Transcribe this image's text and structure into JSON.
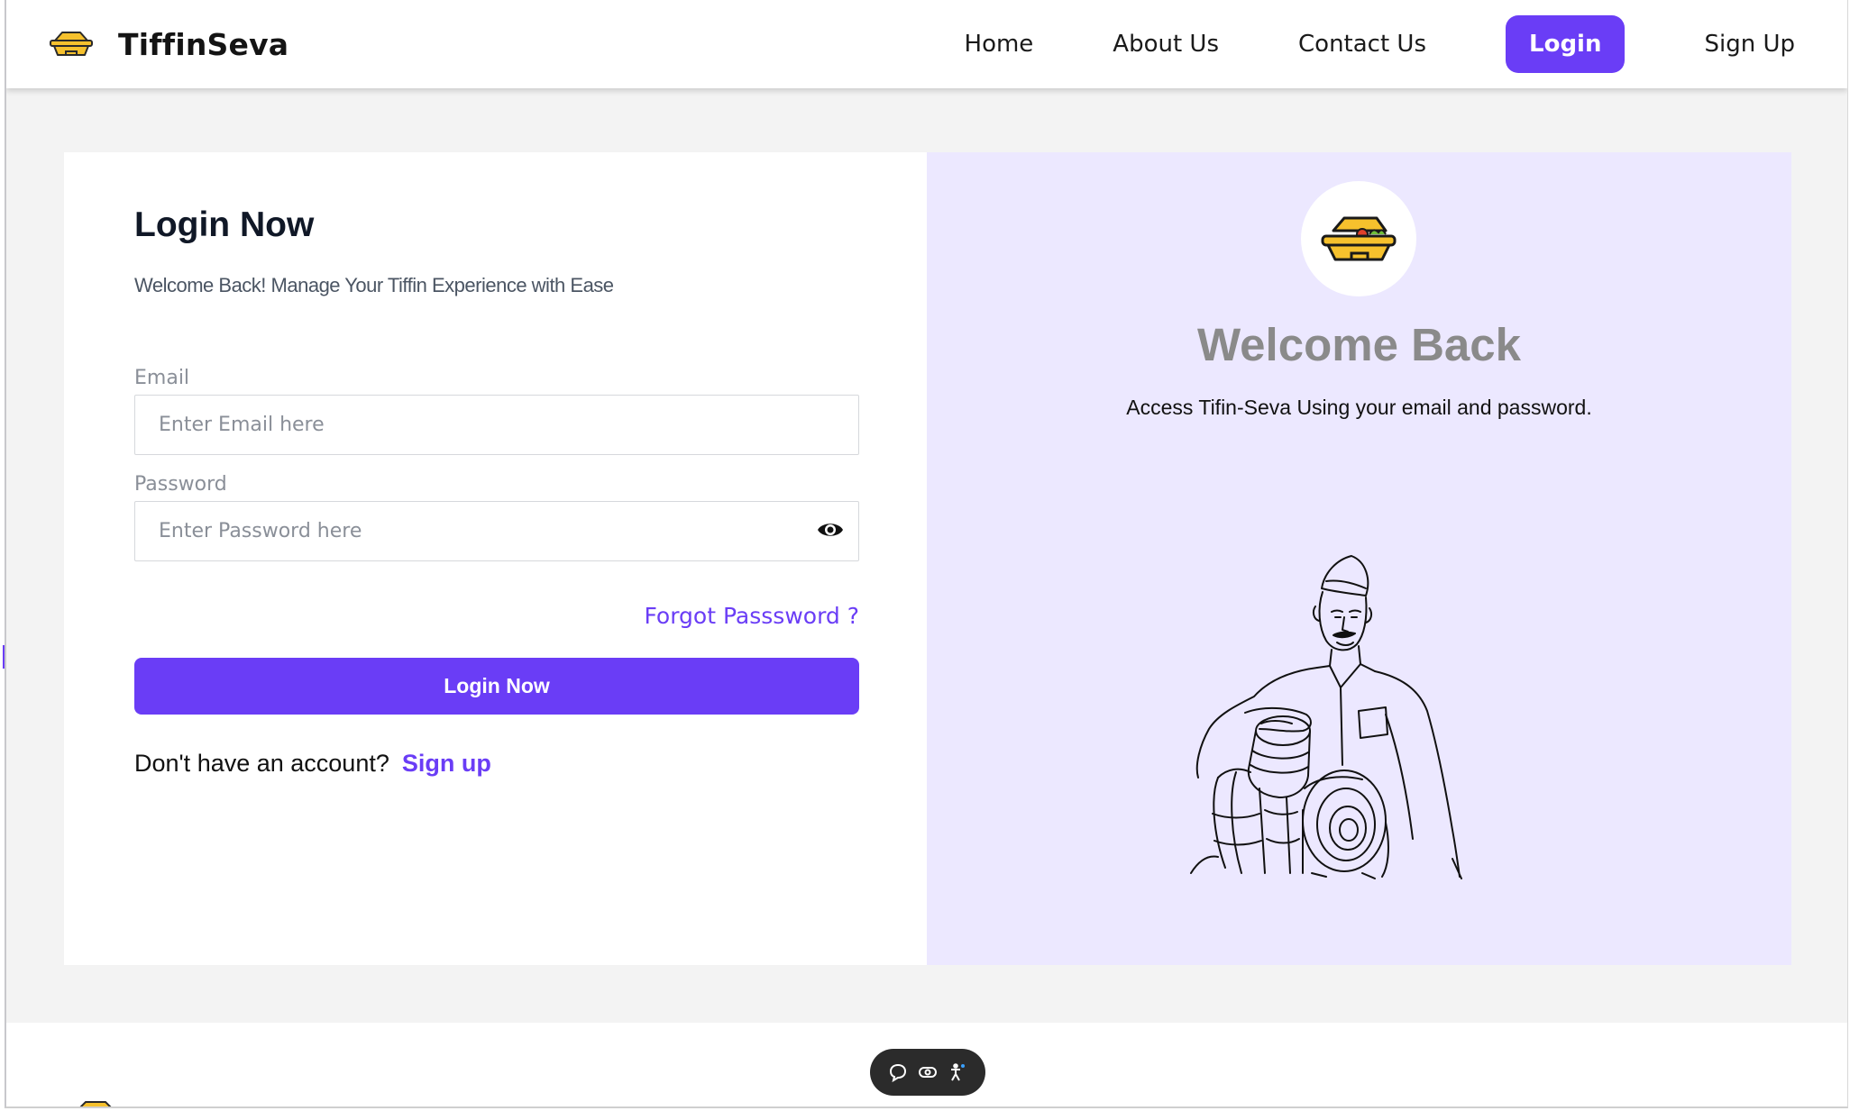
{
  "brand": {
    "name": "TiffinSeva",
    "logo_icon": "tiffin-box-icon"
  },
  "nav": {
    "items": [
      {
        "label": "Home"
      },
      {
        "label": "About Us"
      },
      {
        "label": "Contact Us"
      },
      {
        "label": "Login",
        "active": true
      },
      {
        "label": "Sign Up"
      }
    ]
  },
  "login": {
    "title": "Login Now",
    "subtitle": "Welcome Back! Manage Your Tiffin Experience with Ease",
    "email_label": "Email",
    "email_placeholder": "Enter Email here",
    "email_value": "",
    "password_label": "Password",
    "password_placeholder": "Enter Password here",
    "password_value": "",
    "password_toggle_icon": "eye-icon",
    "forgot_label": "Forgot Passsword ?",
    "submit_label": "Login Now",
    "no_account_text": "Don't have an account?",
    "signup_label": "Sign up"
  },
  "welcome": {
    "title": "Welcome Back",
    "subtitle": "Access Tifin-Seva Using your email and password.",
    "illustration": "dabbawala-illustration"
  },
  "floating_toolbar": {
    "icons": [
      "chat-bubble-icon",
      "toggle-icon",
      "accessibility-icon"
    ]
  },
  "colors": {
    "accent": "#6a3df6",
    "panel_bg": "#ece8ff",
    "page_bg": "#f3f3f3",
    "logo_yellow": "#f6c12d"
  }
}
